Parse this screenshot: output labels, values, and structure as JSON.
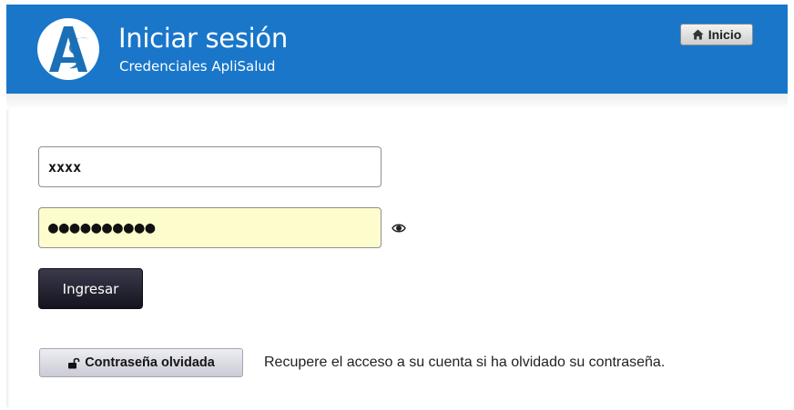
{
  "header": {
    "title": "Iniciar sesión",
    "subtitle": "Credenciales ApliSalud",
    "home_label": "Inicio",
    "background_color": "#1976c9"
  },
  "form": {
    "username_value": "xxxx",
    "password_mask": "●●●●●●●●●●",
    "show_password_icon": "eye-icon",
    "submit_label": "Ingresar",
    "forgot_label": "Contraseña olvidada",
    "forgot_icon": "unlock-icon",
    "recover_text": "Recupere el acceso a su cuenta si ha olvidado su contraseña."
  }
}
